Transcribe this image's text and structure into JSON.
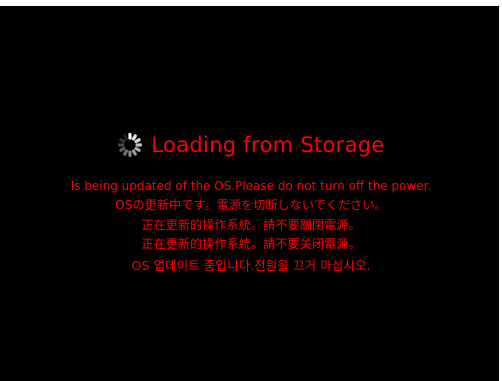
{
  "loading": {
    "title": "Loading from Storage",
    "spinner_icon": "loading-spinner-icon"
  },
  "messages": {
    "english": "Is being updated of the OS.Please do not turn off the power.",
    "japanese": "OSの更新中です。電源を切断しないでください。",
    "chinese_traditional": "正在更新的操作系統。請不要關閉電源。",
    "chinese_simplified": "正在更新的操作系統。請不要关闭電源。",
    "korean": "OS 업데이트 중입니다.전원을 끄거 마십시오."
  },
  "colors": {
    "background": "#000000",
    "text": "#ff0000",
    "spinner": "#ffffff"
  }
}
